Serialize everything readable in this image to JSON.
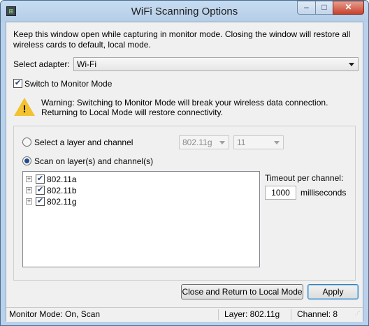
{
  "window": {
    "title": "WiFi Scanning Options",
    "controls": {
      "minimize": "–",
      "maximize": "□",
      "close": "✕"
    }
  },
  "intro_text": "Keep this window open while capturing in monitor mode. Closing the window will restore all wireless cards to default, local mode.",
  "adapter": {
    "label": "Select adapter:",
    "value": "Wi-Fi"
  },
  "monitor_mode": {
    "label": "Switch to Monitor Mode",
    "checked": true
  },
  "warning": {
    "icon": "warning-triangle-icon",
    "text": "Warning: Switching to Monitor Mode will break your wireless data connection. Returning to Local Mode will restore connectivity."
  },
  "scan_options": {
    "select_layer_channel": {
      "label": "Select a layer and channel",
      "selected": false,
      "layer": "802.11g",
      "channel": "11"
    },
    "scan_layers_channels": {
      "label": "Scan on layer(s) and channel(s)",
      "selected": true
    }
  },
  "tree_items": [
    {
      "label": "802.11a",
      "checked": true
    },
    {
      "label": "802.11b",
      "checked": true
    },
    {
      "label": "802.11g",
      "checked": true
    }
  ],
  "timeout": {
    "label": "Timeout per channel:",
    "value": "1000",
    "unit": "milliseconds"
  },
  "buttons": {
    "close_return": "Close and Return to Local Mode",
    "apply": "Apply"
  },
  "status": {
    "mode": "Monitor Mode: On, Scan",
    "layer": "Layer: 802.11g",
    "channel": "Channel: 8"
  }
}
